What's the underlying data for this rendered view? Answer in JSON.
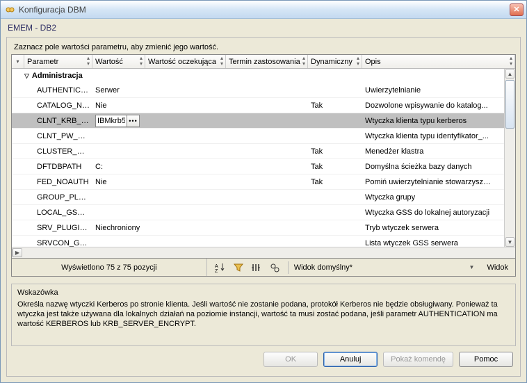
{
  "window": {
    "title": "Konfiguracja DBM",
    "context": "EMEM - DB2"
  },
  "instruction": "Zaznacz pole wartości parametru, aby zmienić jego wartość.",
  "columns": {
    "param": "Parametr",
    "value": "Wartość",
    "pending": "Wartość oczekująca",
    "applied": "Termin zastosowania",
    "dynamic": "Dynamiczny",
    "desc": "Opis"
  },
  "group": "Administracja",
  "rows": [
    {
      "param": "AUTHENTICA...",
      "value": "Serwer",
      "pending": "",
      "term": "",
      "dyn": "",
      "desc": "Uwierzytelnianie"
    },
    {
      "param": "CATALOG_NO...",
      "value": "Nie",
      "pending": "",
      "term": "",
      "dyn": "Tak",
      "desc": "Dozwolone wpisywanie do katalog..."
    },
    {
      "param": "CLNT_KRB_P...",
      "value": "IBMkrb5",
      "pending": "",
      "term": "",
      "dyn": "",
      "desc": "Wtyczka klienta typu kerberos",
      "selected": true,
      "editing": true
    },
    {
      "param": "CLNT_PW_PL...",
      "value": "",
      "pending": "",
      "term": "",
      "dyn": "",
      "desc": "Wtyczka klienta typu identyfikator_..."
    },
    {
      "param": "CLUSTER_MGR",
      "value": "",
      "pending": "",
      "term": "",
      "dyn": "Tak",
      "desc": "Menedżer klastra"
    },
    {
      "param": "DFTDBPATH",
      "value": "C:",
      "pending": "",
      "term": "",
      "dyn": "Tak",
      "desc": "Domyślna ścieżka bazy danych"
    },
    {
      "param": "FED_NOAUTH",
      "value": "Nie",
      "pending": "",
      "term": "",
      "dyn": "Tak",
      "desc": "Pomiń uwierzytelnianie stowarzyszo..."
    },
    {
      "param": "GROUP_PLU...",
      "value": "",
      "pending": "",
      "term": "",
      "dyn": "",
      "desc": "Wtyczka grupy"
    },
    {
      "param": "LOCAL_GSSP...",
      "value": "",
      "pending": "",
      "term": "",
      "dyn": "",
      "desc": "Wtyczka GSS do lokalnej autoryzacji"
    },
    {
      "param": "SRV_PLUGIN...",
      "value": "Niechroniony",
      "pending": "",
      "term": "",
      "dyn": "",
      "desc": "Tryb wtyczek serwera"
    },
    {
      "param": "SRVCON_GSS...",
      "value": "",
      "pending": "",
      "term": "",
      "dyn": "",
      "desc": "Lista wtyczek GSS serwera"
    }
  ],
  "status": {
    "count": "Wyświetlono 75 z 75 pozycji",
    "view_options": "Widok domyślny*",
    "view_label": "Widok"
  },
  "hint": {
    "title": "Wskazówka",
    "body": "Określa nazwę wtyczki Kerberos po stronie klienta.  Jeśli wartość nie zostanie podana, protokół Kerberos nie będzie obsługiwany.  Ponieważ ta wtyczka jest także używana dla lokalnych działań na poziomie instancji, wartość ta musi zostać podana, jeśli parametr AUTHENTICATION ma wartość KERBEROS lub KRB_SERVER_ENCRYPT."
  },
  "buttons": {
    "ok": "OK",
    "cancel": "Anuluj",
    "show_cmd": "Pokaż komendę",
    "help": "Pomoc"
  }
}
